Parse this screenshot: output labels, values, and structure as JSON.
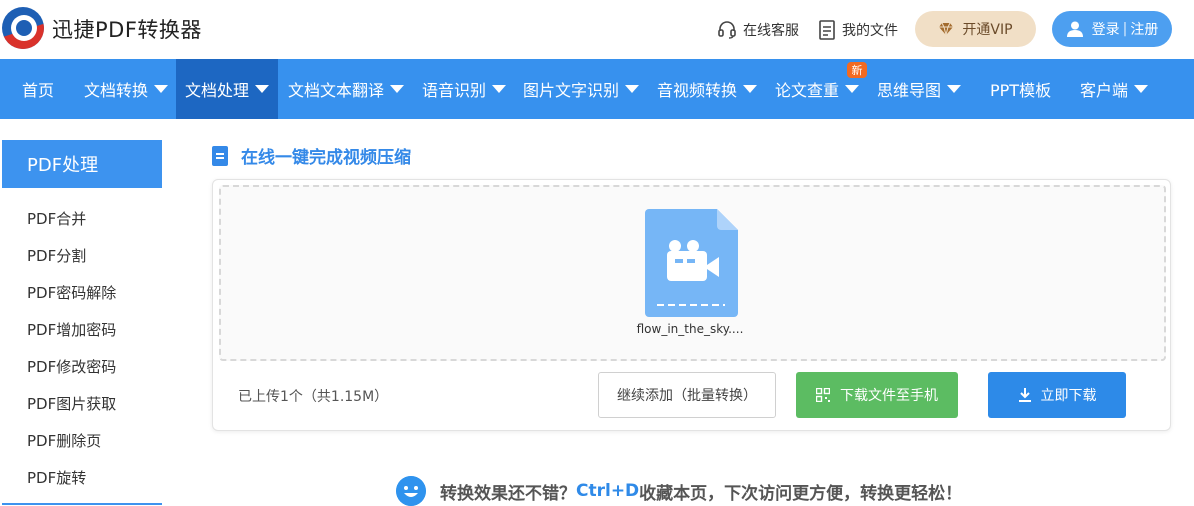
{
  "header": {
    "brand": "迅捷PDF转换器",
    "service_label": "在线客服",
    "files_label": "我的文件",
    "vip_label": "开通VIP",
    "login_label": "登录",
    "register_label": "注册"
  },
  "nav": {
    "items": [
      {
        "label": "首页",
        "dropdown": false
      },
      {
        "label": "文档转换",
        "dropdown": true
      },
      {
        "label": "文档处理",
        "dropdown": true,
        "active": true
      },
      {
        "label": "文档文本翻译",
        "dropdown": true
      },
      {
        "label": "语音识别",
        "dropdown": true
      },
      {
        "label": "图片文字识别",
        "dropdown": true
      },
      {
        "label": "音视频转换",
        "dropdown": true
      },
      {
        "label": "论文查重",
        "dropdown": true
      },
      {
        "label": "思维导图",
        "dropdown": true
      },
      {
        "label": "PPT模板",
        "dropdown": false
      },
      {
        "label": "客户端",
        "dropdown": true
      }
    ],
    "new_badge": "新"
  },
  "sidebar": {
    "title": "PDF处理",
    "items": [
      "PDF合并",
      "PDF分割",
      "PDF密码解除",
      "PDF增加密码",
      "PDF修改密码",
      "PDF图片获取",
      "PDF删除页",
      "PDF旋转"
    ]
  },
  "main": {
    "section_title": "在线一键完成视频压缩",
    "file_name": "flow_in_the_sky....",
    "upload_count": "已上传1个（共1.15M）",
    "add_more_label": "继续添加（批量转换）",
    "send_phone_label": "下载文件至手机",
    "download_label": "立即下载",
    "tip_prefix": "转换效果还不错？",
    "tip_shortcut": "Ctrl+D",
    "tip_suffix": "收藏本页，下次访问更方便，转换更轻松！"
  },
  "colors": {
    "nav_bg": "#3791ee",
    "nav_active": "#1d67c2",
    "green_button": "#5cbc62",
    "blue_button": "#2d8ae8",
    "vip_bg": "#f1dfc6"
  }
}
